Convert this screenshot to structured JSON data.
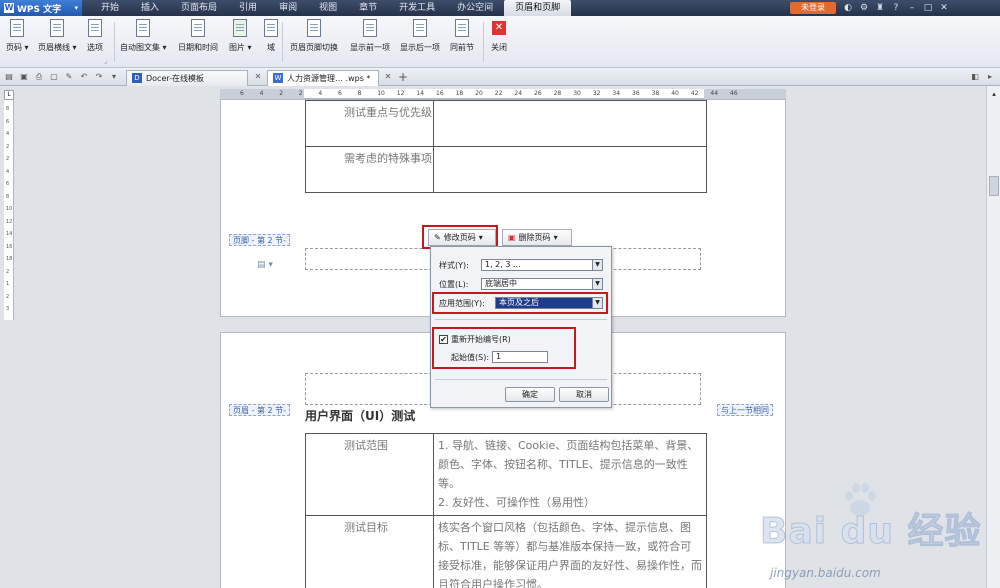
{
  "app": {
    "name": "WPS 文字"
  },
  "menu": {
    "tabs": [
      "开始",
      "插入",
      "页面布局",
      "引用",
      "审阅",
      "视图",
      "章节",
      "开发工具",
      "办公空间",
      "页眉和页脚"
    ],
    "active_tab": "页眉和页脚",
    "login": "未登录"
  },
  "ribbon": {
    "page_number": "页码",
    "header_line": "页眉横线",
    "options": "选项",
    "auto_text": "自动图文集",
    "date_time": "日期和时间",
    "picture": "图片",
    "field": "域",
    "switch_hf": "页眉页脚切换",
    "show_prev": "显示前一项",
    "show_next": "显示后一项",
    "same_as_prev": "同前节",
    "close": "关闭"
  },
  "doc_tabs": [
    {
      "label": "Docer-在线模板"
    },
    {
      "label": "人力资源管理… .wps *"
    }
  ],
  "ruler": {
    "labels": [
      "6",
      "4",
      "2",
      "2",
      "4",
      "6",
      "8",
      "10",
      "12",
      "14",
      "16",
      "18",
      "20",
      "22",
      "24",
      "26",
      "28",
      "30",
      "32",
      "34",
      "36",
      "38",
      "40",
      "42",
      "44",
      "46"
    ],
    "vlabels": [
      "8",
      "6",
      "4",
      "2",
      "2",
      "4",
      "6",
      "8",
      "10",
      "12",
      "14",
      "16",
      "18",
      "2",
      "1",
      "2",
      "3"
    ]
  },
  "page1": {
    "rows": [
      {
        "label": "测试重点与优先级"
      },
      {
        "label": "需考虑的特殊事项"
      }
    ],
    "footer_label": "页脚 - 第 2 节-"
  },
  "page_number_buttons": {
    "modify": "修改页码",
    "delete": "删除页码"
  },
  "dialog": {
    "style_label": "样式(Y):",
    "style_value": "1, 2, 3 ...",
    "position_label": "位置(L):",
    "position_value": "底端居中",
    "scope_label": "应用范围(Y):",
    "scope_value": "本页及之后",
    "restart_label": "重新开始编号(R)",
    "restart_checked": true,
    "start_label": "起始值(S):",
    "start_value": "1",
    "ok": "确定",
    "cancel": "取消"
  },
  "page2": {
    "header_label": "页眉 - 第 2 节-",
    "same_as_prev_label": "与上一节相同",
    "title": "用户界面（UI）测试",
    "rows": [
      {
        "label": "测试范围",
        "content": "1. 导航、链接、Cookie、页面结构包括菜单、背景、颜色、字体、按钮名称、TITLE、提示信息的一致性等。",
        "content2": "2. 友好性、可操作性（易用性）"
      },
      {
        "label": "测试目标",
        "content": "核实各个窗口风格（包括颜色、字体、提示信息、图标、TITLE 等等）都与基准版本保持一致，或符合可接受标准，能够保证用户界面的友好性、易操作性，而且符合用户操作习惯。"
      }
    ]
  },
  "watermark": {
    "brand": "Bai du 经验",
    "url": "jingyan.baidu.com"
  }
}
